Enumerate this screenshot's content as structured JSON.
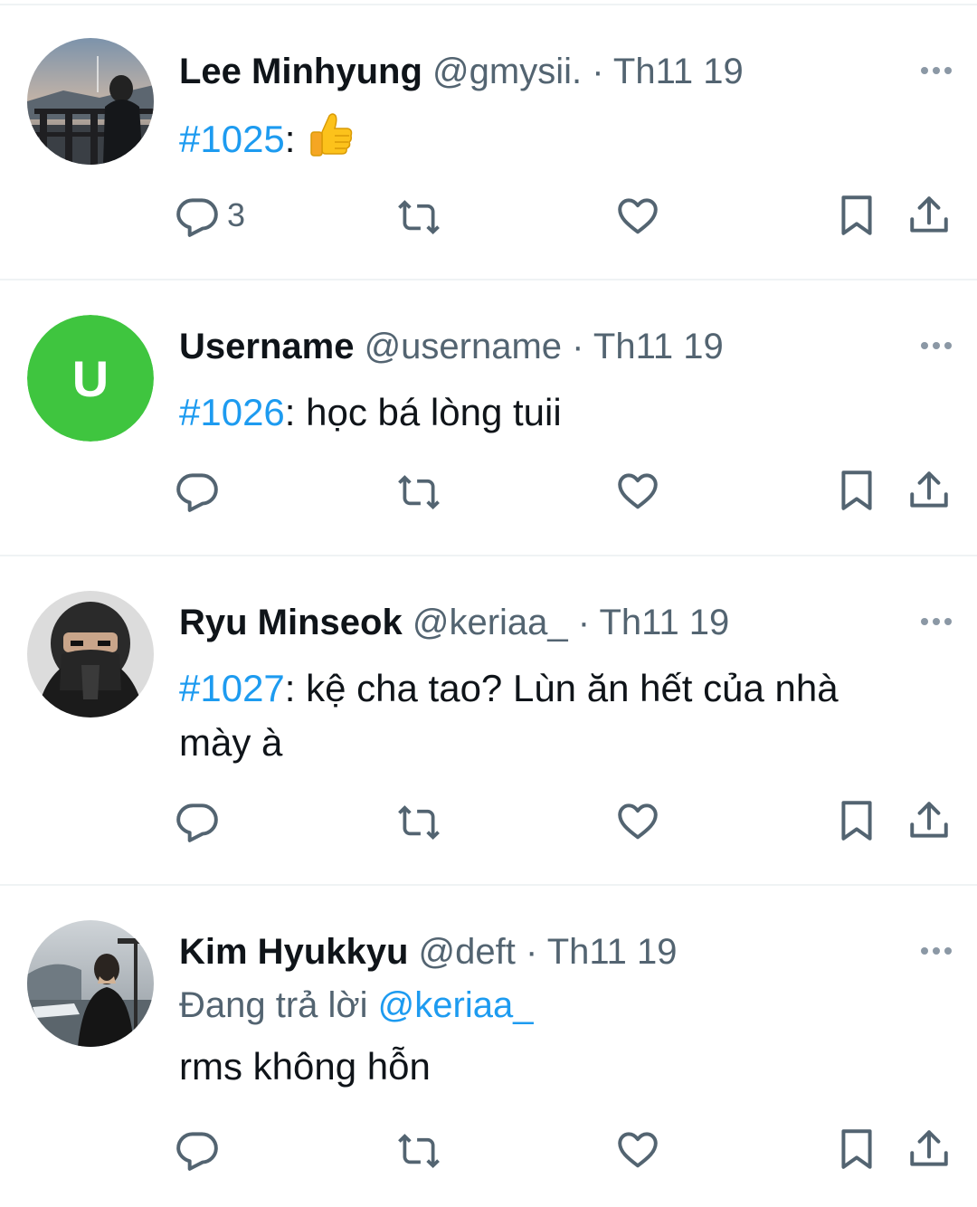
{
  "tweets": [
    {
      "name": "Lee Minhyung",
      "handle": "@gmysii.",
      "separator": "·",
      "time": "Th11 19",
      "hashtag": "#1025",
      "colon": ":",
      "text": "",
      "emoji": "thumbs-up",
      "reply_count": "3",
      "avatar": "photo"
    },
    {
      "name": "Username",
      "handle": "@username",
      "separator": "·",
      "time": "Th11 19",
      "hashtag": "#1026",
      "colon": ":",
      "text": " học bá lòng tuii",
      "reply_count": "",
      "avatar_letter": "U",
      "avatar_color": "#3fc53f"
    },
    {
      "name": "Ryu Minseok",
      "handle": "@keriaa_",
      "separator": "·",
      "time": "Th11 19",
      "hashtag": "#1027",
      "colon": ":",
      "text": " kệ cha tao? Lùn ăn hết của nhà mày à",
      "reply_count": "",
      "avatar": "photo"
    },
    {
      "name": "Kim Hyukkyu",
      "handle": "@deft",
      "separator": "·",
      "time": "Th11 19",
      "reply_prefix": "Đang trả lời ",
      "reply_to": "@keriaa_",
      "text": "rms không hỗn",
      "reply_count": "",
      "avatar": "photo"
    }
  ],
  "icons": {
    "reply": "reply-icon",
    "retweet": "retweet-icon",
    "like": "like-icon",
    "bookmark": "bookmark-icon",
    "share": "share-icon",
    "more": "more-icon"
  },
  "colors": {
    "link": "#1d9bf0",
    "secondary_text": "#536471",
    "divider": "#eff3f4"
  }
}
